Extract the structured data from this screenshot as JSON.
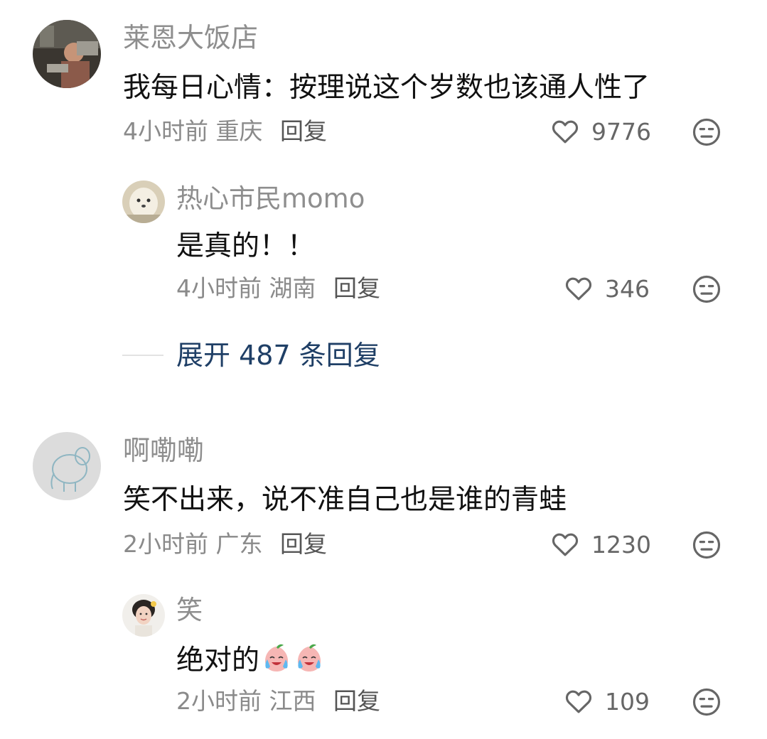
{
  "comments": [
    {
      "user": "莱恩大饭店",
      "text": "我每日心情：按理说这个岁数也该通人性了",
      "time": "4小时前",
      "location": "重庆",
      "reply_label": "回复",
      "likes": "9776",
      "replies": [
        {
          "user": "热心市民momo",
          "text": "是真的！！",
          "time": "4小时前",
          "location": "湖南",
          "reply_label": "回复",
          "likes": "346"
        }
      ],
      "expand": {
        "prefix": "展开",
        "count": "487",
        "suffix": "条回复"
      }
    },
    {
      "user": "啊嘞嘞",
      "text": "笑不出来，说不准自己也是谁的青蛙",
      "time": "2小时前",
      "location": "广东",
      "reply_label": "回复",
      "likes": "1230",
      "replies": [
        {
          "user": "笑",
          "text": "绝对的",
          "emojis": [
            "crying-laughing-peach-emoji",
            "crying-laughing-peach-emoji"
          ],
          "time": "2小时前",
          "location": "江西",
          "reply_label": "回复",
          "likes": "109"
        }
      ]
    }
  ],
  "icons": {
    "like": "heart-outline-icon",
    "dislike": "meh-face-icon"
  },
  "colors": {
    "name": "#8e8e8e",
    "text": "#111111",
    "meta": "#8a8a8a",
    "expand": "#1f3f66",
    "icon": "#666666"
  }
}
